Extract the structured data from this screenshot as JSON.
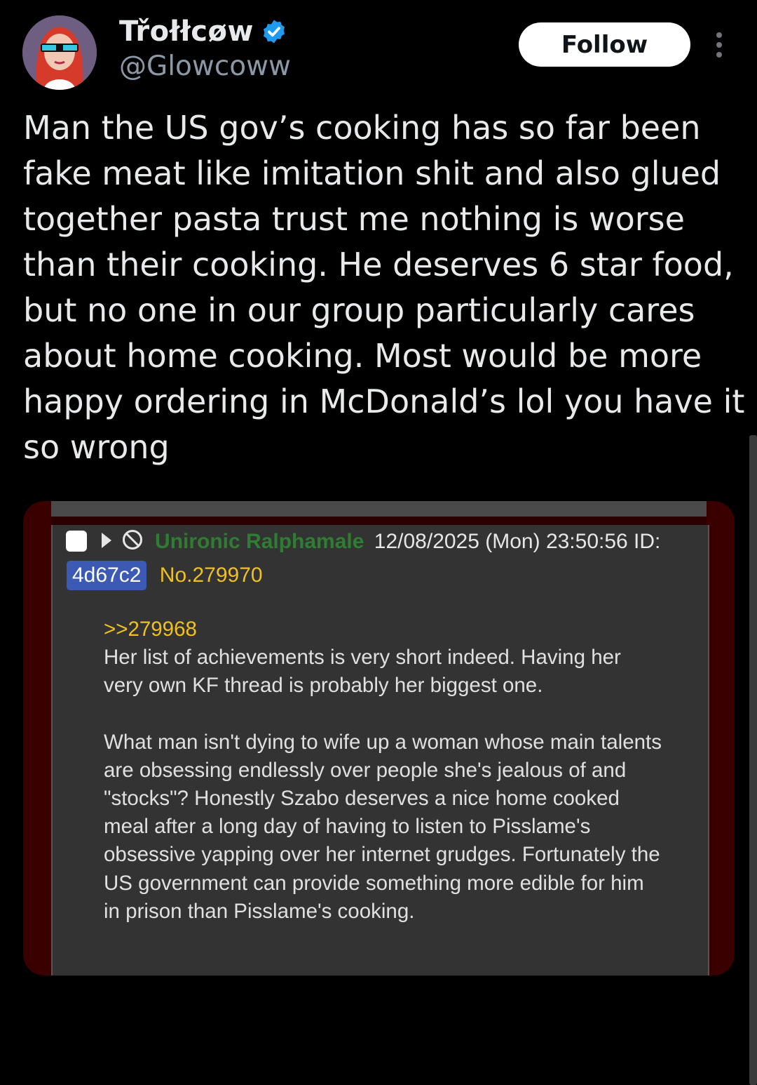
{
  "author": {
    "display_name": "Třołłcøw",
    "handle": "@Glowcoww",
    "verified_color": "#1d9bf0"
  },
  "actions": {
    "follow_label": "Follow",
    "more_icon": "more-vertical-icon"
  },
  "tweet": {
    "text": "Man the US gov’s cooking has so far been fake meat like imitation shit and also glued together pasta trust me nothing is worse than their cooking. He deserves 6 star food, but no one in our group particularly cares about home cooking. Most would be more happy ordering in McDonald’s lol you have it so wrong"
  },
  "embedded_post": {
    "poster_name": "Unironic Ralphamale",
    "datetime": "12/08/2025 (Mon) 23:50:56 ID:",
    "id": "4d67c2",
    "post_number": "No.279970",
    "quote_link": ">>279968",
    "paragraph1": "Her list of achievements is very short indeed. Having her very own KF thread is probably her biggest one.",
    "paragraph2": "What man isn't dying to wife up a woman whose main talents are obsessing endlessly over people she's jealous of and \"stocks\"? Honestly Szabo deserves a nice home cooked meal after a long day of having to listen to Pisslame's obsessive yapping over her internet grudges. Fortunately the US government can provide something more edible for him in prison than Pisslame's cooking.",
    "colors": {
      "name": "#2e7d32",
      "post_number": "#f0c020",
      "id_badge": "#3c5ab4",
      "background": "#333333",
      "frame": "#3a0000"
    }
  }
}
